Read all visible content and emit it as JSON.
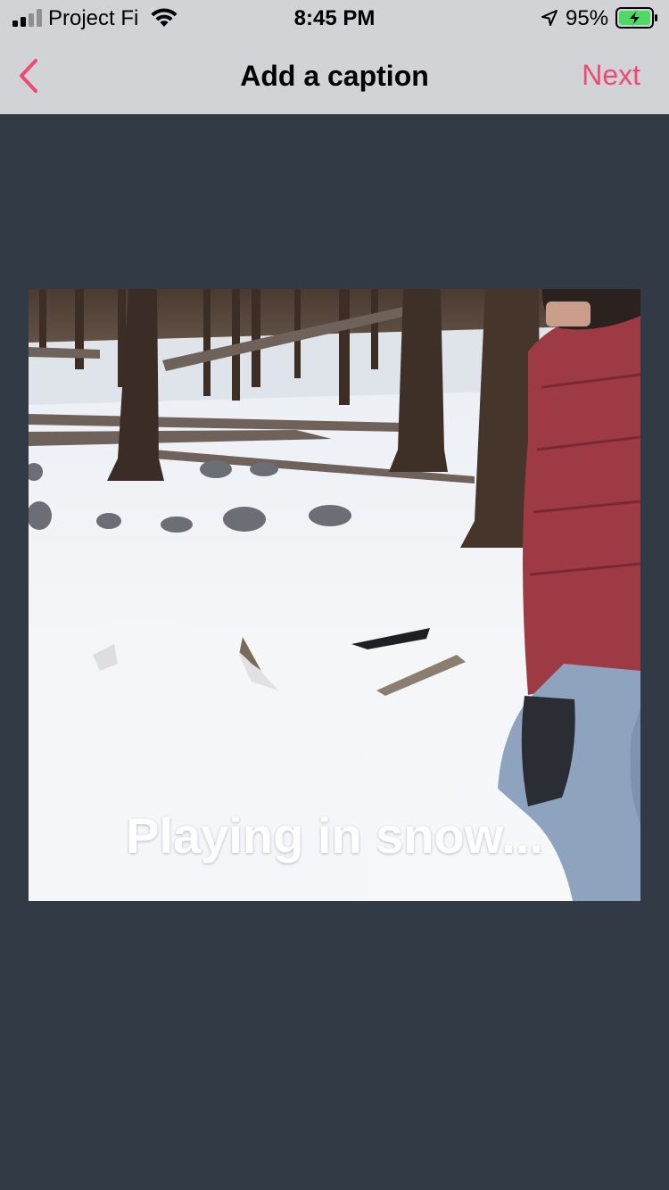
{
  "status_bar": {
    "carrier": "Project Fi",
    "time": "8:45 PM",
    "battery_percent": "95%",
    "icons": [
      "signal-icon",
      "wifi-icon",
      "location-arrow-icon",
      "battery-charging-icon"
    ]
  },
  "nav": {
    "back_icon": "chevron-left-icon",
    "title": "Add a caption",
    "next_label": "Next"
  },
  "photo": {
    "caption": "Playing in snow..."
  },
  "colors": {
    "accent": "#ef4a73",
    "chrome_background": "#d2d3d6",
    "page_background": "#323a45",
    "battery_fill": "#4cd964"
  }
}
